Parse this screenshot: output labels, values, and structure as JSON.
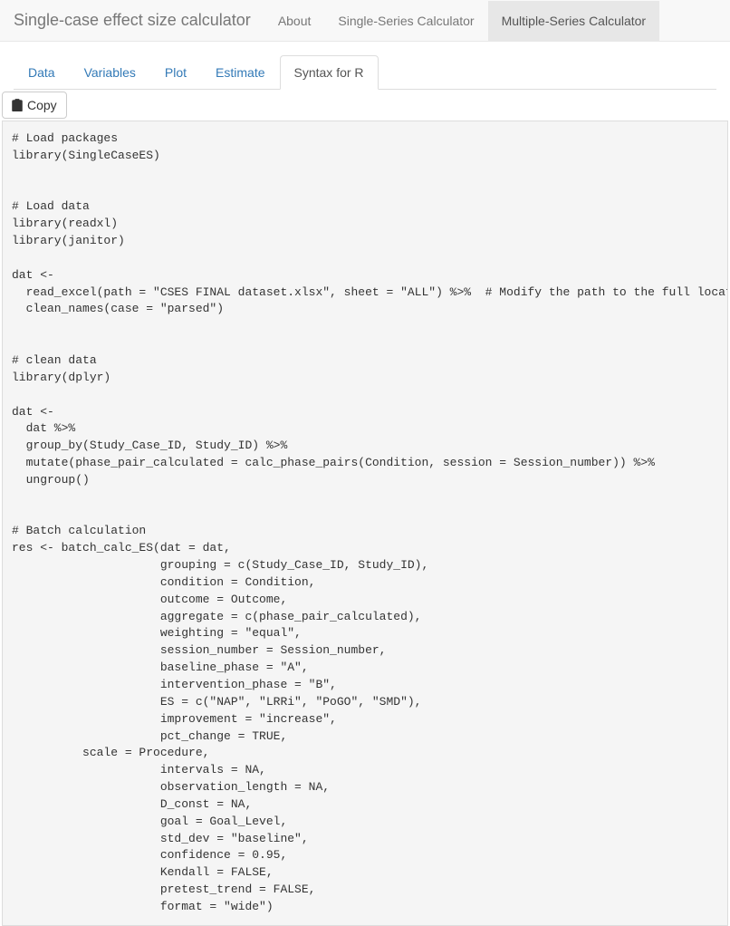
{
  "topnav": {
    "brand": "Single-case effect size calculator",
    "items": [
      {
        "label": "About",
        "active": false
      },
      {
        "label": "Single-Series Calculator",
        "active": false
      },
      {
        "label": "Multiple-Series Calculator",
        "active": true
      }
    ]
  },
  "subtabs": [
    {
      "label": "Data",
      "active": false
    },
    {
      "label": "Variables",
      "active": false
    },
    {
      "label": "Plot",
      "active": false
    },
    {
      "label": "Estimate",
      "active": false
    },
    {
      "label": "Syntax for R",
      "active": true
    }
  ],
  "copy_button": {
    "label": "Copy"
  },
  "code": "# Load packages\nlibrary(SingleCaseES)\n\n\n# Load data\nlibrary(readxl)\nlibrary(janitor)\n\ndat <-\n  read_excel(path = \"CSES FINAL dataset.xlsx\", sheet = \"ALL\") %>%  # Modify the path to the full location of your file\n  clean_names(case = \"parsed\")\n\n\n# clean data\nlibrary(dplyr)\n\ndat <-\n  dat %>%\n  group_by(Study_Case_ID, Study_ID) %>%\n  mutate(phase_pair_calculated = calc_phase_pairs(Condition, session = Session_number)) %>%\n  ungroup()\n\n\n# Batch calculation\nres <- batch_calc_ES(dat = dat,\n                     grouping = c(Study_Case_ID, Study_ID),\n                     condition = Condition,\n                     outcome = Outcome,\n                     aggregate = c(phase_pair_calculated),\n                     weighting = \"equal\",\n                     session_number = Session_number,\n                     baseline_phase = \"A\",\n                     intervention_phase = \"B\",\n                     ES = c(\"NAP\", \"LRRi\", \"PoGO\", \"SMD\"),\n                     improvement = \"increase\",\n                     pct_change = TRUE,\n          scale = Procedure,\n                     intervals = NA,\n                     observation_length = NA,\n                     D_const = NA,\n                     goal = Goal_Level,\n                     std_dev = \"baseline\",\n                     confidence = 0.95,\n                     Kendall = FALSE,\n                     pretest_trend = FALSE,\n                     format = \"wide\")"
}
